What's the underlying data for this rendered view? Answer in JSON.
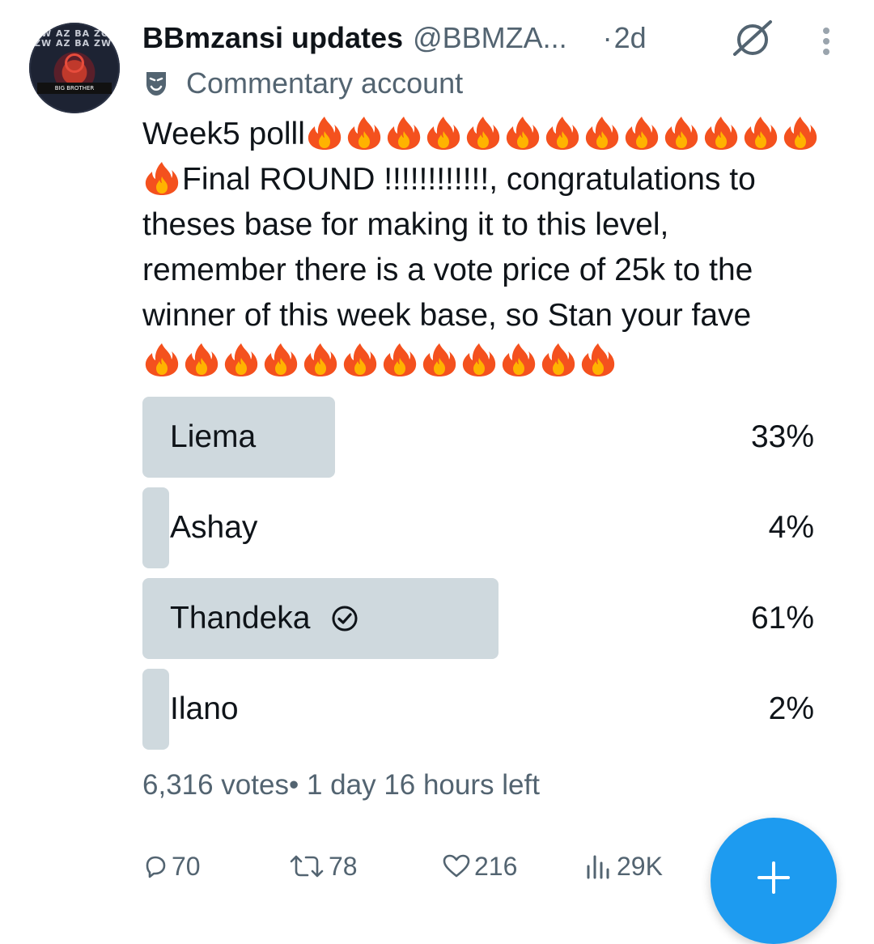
{
  "author": {
    "name": "BBmzansi updates",
    "handle": "@BBMZA...",
    "time": "2d",
    "separator": "·",
    "account_label": "Commentary account",
    "avatar_text": "BIG BROTHER"
  },
  "tweet": {
    "line1": "Week5 polll",
    "line2": "Final ROUND !!!!!!!!!!!!, congratulations to",
    "line3": "theses base for making it to this level,",
    "line4": "remember there is a vote price of 25k to the",
    "line5": "winner of this week base, so Stan your fave",
    "emoji": "fire-emoji"
  },
  "poll": {
    "options": [
      {
        "label": "Liema",
        "percent": "33%",
        "value": 33
      },
      {
        "label": "Ashay",
        "percent": "4%",
        "value": 4
      },
      {
        "label": "Thandeka",
        "percent": "61%",
        "value": 61,
        "selected": true
      },
      {
        "label": "Ilano",
        "percent": "2%",
        "value": 2
      }
    ],
    "votes": "6,316 votes",
    "meta_separator": "•",
    "time_left": "1 day 16 hours left"
  },
  "actions": {
    "replies": "70",
    "reposts": "78",
    "likes": "216",
    "views": "29K"
  },
  "colors": {
    "accent": "#1d9bf0",
    "bar": "#cfd9de",
    "secondary_text": "#536471"
  }
}
